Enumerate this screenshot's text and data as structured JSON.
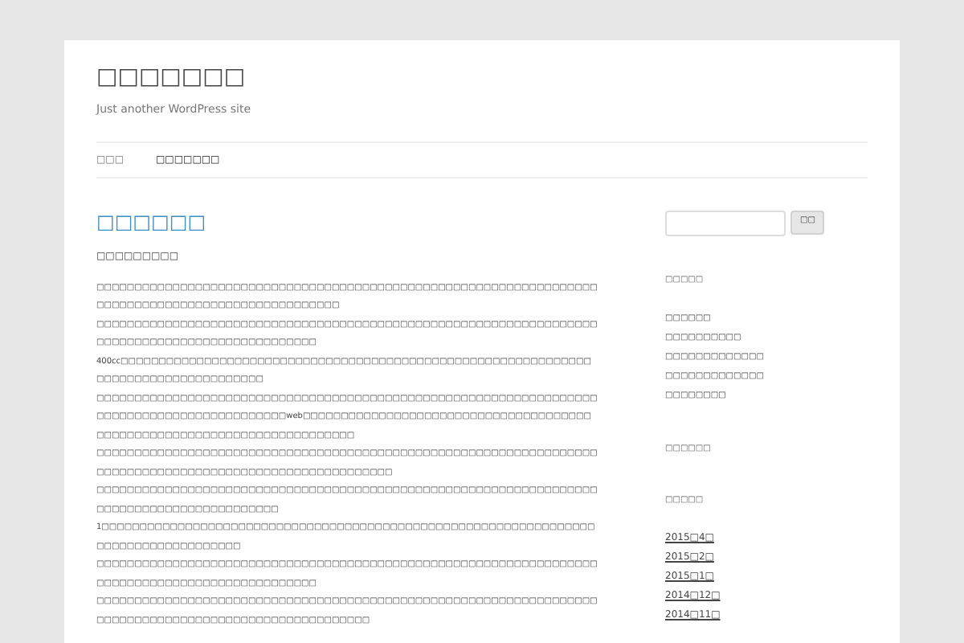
{
  "site": {
    "title": "□□□□□□□",
    "tagline": "Just another WordPress site"
  },
  "nav": [
    {
      "label": "□□□",
      "selected": false
    },
    {
      "label": "□□□□□□□",
      "selected": true
    }
  ],
  "post": {
    "title": "□□□□□□",
    "subtitle": "□□□□□□□□□",
    "paragraphs": [
      "□□□□□□□□□□□□□□□□□□□□□□□□□□□□□□□□□□□□□□□□□□□□□□□□□□□□□□□□□□□□□□□□□□□□□□□□□□□□□□□□□□□□□□□□□□□□□□□□□□",
      "□□□□□□□□□□□□□□□□□□□□□□□□□□□□□□□□□□□□□□□□□□□□□□□□□□□□□□□□□□□□□□□□□□□□□□□□□□□□□□□□□□□□□□□□□□□□□□□",
      "400cc□□□□□□□□□□□□□□□□□□□□□□□□□□□□□□□□□□□□□□□□□□□□□□□□□□□□□□□□□□□□□□□□□□□□□□□□□□□□□□□□□□□□",
      "□□□□□□□□□□□□□□□□□□□□□□□□□□□□□□□□□□□□□□□□□□□□□□□□□□□□□□□□□□□□□□□□□□□□□□□□□□□□□□□□□□□□□□□□□□□web□□□□□□□□□□□□□□□□□□□□□□□□□□□□□□□□□□□□□□□□□□□□□□□□□□□□□□□□□□□□□□□□□□□□□□□□",
      "□□□□□□□□□□□□□□□□□□□□□□□□□□□□□□□□□□□□□□□□□□□□□□□□□□□□□□□□□□□□□□□□□□□□□□□□□□□□□□□□□□□□□□□□□□□□□□□□□□□□□□□□□",
      "□□□□□□□□□□□□□□□□□□□□□□□□□□□□□□□□□□□□□□□□□□□□□□□□□□□□□□□□□□□□□□□□□□□□□□□□□□□□□□□□□□□□□□□□□□",
      "1□□□□□□□□□□□□□□□□□□□□□□□□□□□□□□□□□□□□□□□□□□□□□□□□□□□□□□□□□□□□□□□□□□□□□□□□□□□□□□□□□□□□",
      "□□□□□□□□□□□□□□□□□□□□□□□□□□□□□□□□□□□□□□□□□□□□□□□□□□□□□□□□□□□□□□□□□□□□□□□□□□□□□□□□□□□□□□□□□□□□□□□",
      "□□□□□□□□□□□□□□□□□□□□□□□□□□□□□□□□□□□□□□□□□□□□□□□□□□□□□□□□□□□□□□□□□□□□□□□□□□□□□□□□□□□□□□□□□□□□□□□□□□□□□□"
    ]
  },
  "sidebar": {
    "search_button": "□□",
    "widgets": [
      {
        "title": "□□□□□",
        "items": [
          "□□□□□□",
          "□□□□□□□□□□",
          "□□□□□□□□□□□□□",
          "□□□□□□□□□□□□□",
          "□□□□□□□□"
        ]
      },
      {
        "title": "□□□□□□"
      },
      {
        "title": "□□□□□",
        "items": [
          "2015□4□",
          "2015□2□",
          "2015□1□",
          "2014□12□",
          "2014□11□"
        ]
      }
    ]
  }
}
